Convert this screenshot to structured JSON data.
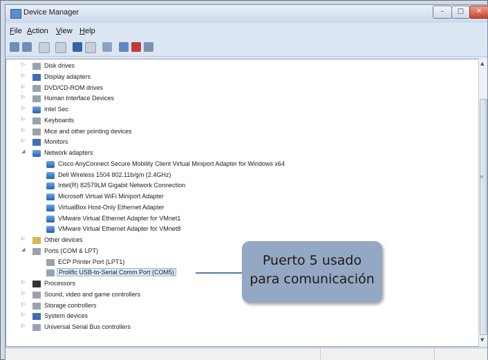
{
  "window": {
    "title": "Device Manager",
    "buttons": {
      "min": "–",
      "max": "□",
      "close": "✕"
    }
  },
  "menu": [
    "File",
    "Action",
    "View",
    "Help"
  ],
  "toolbar": [
    "back-arrow-icon",
    "forward-arrow-icon",
    "show-hide-tree-icon",
    "properties-icon",
    "help-icon",
    "view-icon",
    "update-driver-icon",
    "uninstall-icon",
    "disable-icon",
    "scan-hardware-icon"
  ],
  "tree": [
    {
      "label": "Disk drives",
      "indent": 0,
      "icon": "gray",
      "expander": "▷"
    },
    {
      "label": "Display adapters",
      "indent": 0,
      "icon": "blue",
      "expander": "▷"
    },
    {
      "label": "DVD/CD-ROM drives",
      "indent": 0,
      "icon": "gray",
      "expander": "▷"
    },
    {
      "label": "Human Interface Devices",
      "indent": 0,
      "icon": "gray",
      "expander": "▷"
    },
    {
      "label": "Intel Sec",
      "indent": 0,
      "icon": "net",
      "expander": "▷"
    },
    {
      "label": "Keyboards",
      "indent": 0,
      "icon": "gray",
      "expander": "▷"
    },
    {
      "label": "Mice and other pointing devices",
      "indent": 0,
      "icon": "gray",
      "expander": "▷"
    },
    {
      "label": "Monitors",
      "indent": 0,
      "icon": "blue",
      "expander": "▷"
    },
    {
      "label": "Network adapters",
      "indent": 0,
      "icon": "net",
      "expander": "◢"
    },
    {
      "label": "Cisco AnyConnect Secure Mobility Client Virtual Miniport Adapter for Windows x64",
      "indent": 1,
      "icon": "net"
    },
    {
      "label": "Dell Wireless 1504 802.11b/g/n (2.4GHz)",
      "indent": 1,
      "icon": "net"
    },
    {
      "label": "Intel(R) 82579LM Gigabit Network Connection",
      "indent": 1,
      "icon": "net"
    },
    {
      "label": "Microsoft Virtual WiFi Miniport Adapter",
      "indent": 1,
      "icon": "net"
    },
    {
      "label": "VirtualBox Host-Only Ethernet Adapter",
      "indent": 1,
      "icon": "net"
    },
    {
      "label": "VMware Virtual Ethernet Adapter for VMnet1",
      "indent": 1,
      "icon": "net"
    },
    {
      "label": "VMware Virtual Ethernet Adapter for VMnet8",
      "indent": 1,
      "icon": "net"
    },
    {
      "label": "Other devices",
      "indent": 0,
      "icon": "yellow",
      "expander": "▷"
    },
    {
      "label": "Ports (COM & LPT)",
      "indent": 0,
      "icon": "gray",
      "expander": "◢"
    },
    {
      "label": "ECP Printer Port (LPT1)",
      "indent": 1,
      "icon": "gray"
    },
    {
      "label": "Prolific USB-to-Serial Comm Port (COM5)",
      "indent": 1,
      "icon": "gray",
      "selected": true
    },
    {
      "label": "Processors",
      "indent": 0,
      "icon": "dark",
      "expander": "▷"
    },
    {
      "label": "Sound, video and game controllers",
      "indent": 0,
      "icon": "gray",
      "expander": "▷"
    },
    {
      "label": "Storage controllers",
      "indent": 0,
      "icon": "gray",
      "expander": "▷"
    },
    {
      "label": "System devices",
      "indent": 0,
      "icon": "blue",
      "expander": "▷"
    },
    {
      "label": "Universal Serial Bus controllers",
      "indent": 0,
      "icon": "gray",
      "expander": "▷"
    }
  ],
  "callout": {
    "line1": "Puerto 5 usado",
    "line2": "para comunicación"
  }
}
